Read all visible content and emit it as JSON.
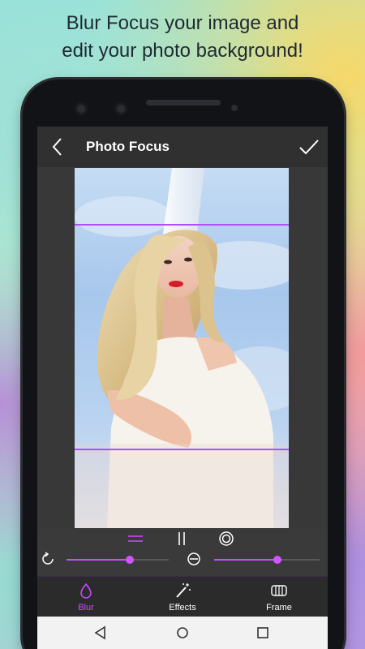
{
  "promo": {
    "line1": "Blur Focus your image and",
    "line2": "edit your photo background!"
  },
  "appbar": {
    "title": "Photo Focus",
    "back_icon": "chevron-left-icon",
    "confirm_icon": "checkmark-icon"
  },
  "editor": {
    "focus_band_top_fraction": 0.156,
    "focus_band_bottom_fraction": 0.78,
    "accent_color": "#b24dff"
  },
  "controls": {
    "modes": [
      {
        "name": "linear-mode",
        "icon": "horizontal-lines-icon",
        "active": true
      },
      {
        "name": "mirror-mode",
        "icon": "vertical-lines-icon",
        "active": false
      },
      {
        "name": "radial-mode",
        "icon": "circle-target-icon",
        "active": false
      }
    ],
    "rotation_slider_value": 0.62,
    "blur_slider_value": 0.6
  },
  "tabs": [
    {
      "label": "Blur",
      "icon": "blur-drop-icon",
      "active": true,
      "color": "#c84dff"
    },
    {
      "label": "Effects",
      "icon": "magic-wand-icon",
      "active": false,
      "color": "#ffffff"
    },
    {
      "label": "Frame",
      "icon": "frame-icon",
      "active": false,
      "color": "#ffffff"
    }
  ],
  "navbar": {
    "back": "nav-back-icon",
    "home": "nav-home-icon",
    "recents": "nav-recents-icon"
  }
}
